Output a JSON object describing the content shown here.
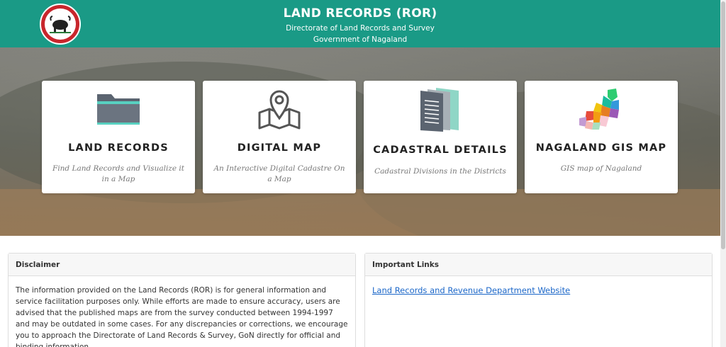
{
  "header": {
    "title": "LAND RECORDS (ROR)",
    "subtitle1": "Directorate of Land Records and Survey",
    "subtitle2": "Government of Nagaland"
  },
  "cards": [
    {
      "title": "LAND RECORDS",
      "description": "Find Land Records and Visualize it in a Map",
      "icon": "folder-icon"
    },
    {
      "title": "DIGITAL MAP",
      "description": "An Interactive Digital Cadastre On a Map",
      "icon": "map-pin-icon"
    },
    {
      "title": "CADASTRAL DETAILS",
      "description": "Cadastral Divisions in the Districts",
      "icon": "documents-icon"
    },
    {
      "title": "NAGALAND GIS MAP",
      "description": "GIS map of Nagaland",
      "icon": "gis-map-icon"
    }
  ],
  "disclaimer": {
    "heading": "Disclaimer",
    "text": "The information provided on the Land Records (ROR) is for general information and service facilitation purposes only. While efforts are made to ensure accuracy, users are advised that the published maps are from the survey conducted between 1994-1997 and may be outdated in some cases. For any discrepancies or corrections, we encourage you to approach the Directorate of Land Records & Survey, GoN directly for official and binding information."
  },
  "links": {
    "heading": "Important Links",
    "items": [
      "Land Records and Revenue Department Website"
    ]
  },
  "colors": {
    "header": "#1a9a86",
    "link": "#1a66c8"
  }
}
